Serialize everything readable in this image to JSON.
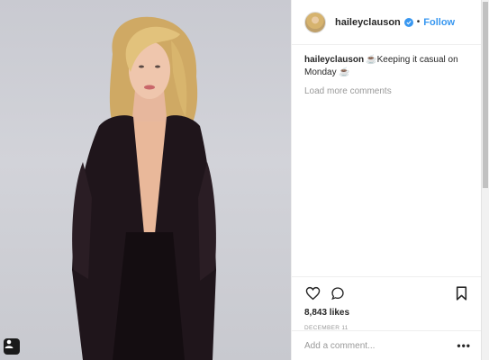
{
  "post": {
    "username": "haileyclauson",
    "follow_label": "Follow",
    "separator": "•",
    "caption_user": "haileyclauson",
    "caption_text": "☕Keeping it casual on Monday ☕",
    "load_more": "Load more comments",
    "likes": "8,843 likes",
    "date": "DECEMBER 11",
    "comment_placeholder": "Add a comment...",
    "more_label": "•••"
  },
  "icons": {
    "verified": "verified-badge-icon",
    "like": "heart-icon",
    "comment": "comment-bubble-icon",
    "save": "bookmark-icon",
    "tag": "user-tag-icon"
  },
  "colors": {
    "accent": "#3897f0",
    "text": "#262626",
    "muted": "#999999",
    "border": "#efefef"
  }
}
